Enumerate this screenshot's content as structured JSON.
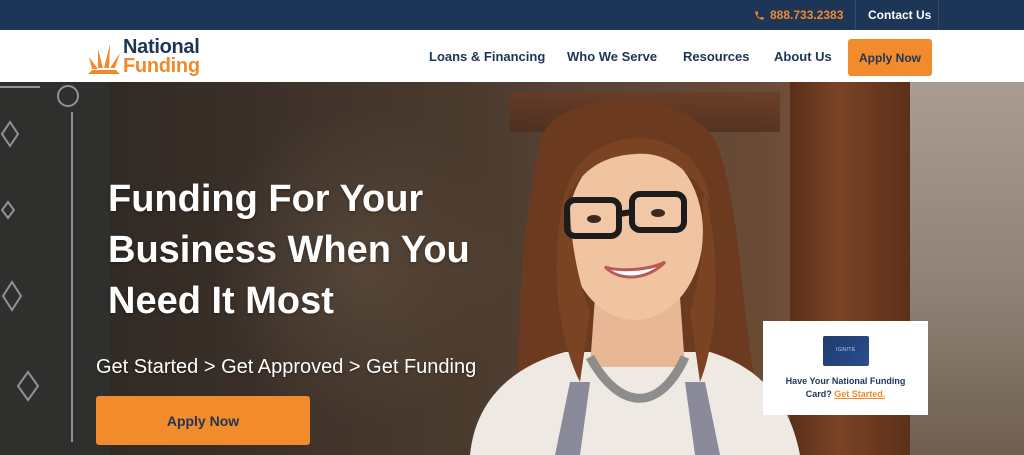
{
  "topbar": {
    "phone": "888.733.2383",
    "contact_label": "Contact Us"
  },
  "logo": {
    "line1": "National",
    "line2": "Funding"
  },
  "nav": {
    "items": [
      {
        "label": "Loans & Financing"
      },
      {
        "label": "Who We Serve"
      },
      {
        "label": "Resources"
      },
      {
        "label": "About Us"
      }
    ],
    "apply_label": "Apply Now"
  },
  "hero": {
    "title_lines": [
      "Funding For Your",
      "Business When You",
      "Need It Most"
    ],
    "steps": "Get Started > Get Approved > Get Funding",
    "apply_label": "Apply Now"
  },
  "card_promo": {
    "card_text": "IGNITE",
    "text_line1": "Have Your National Funding",
    "text_line2_prefix": "Card?",
    "link_label": "Get Started."
  },
  "colors": {
    "navy": "#1d3557",
    "orange": "#f18a2b"
  },
  "icons": {
    "phone": "phone-icon",
    "logo_mark": "sunburst-icon"
  }
}
